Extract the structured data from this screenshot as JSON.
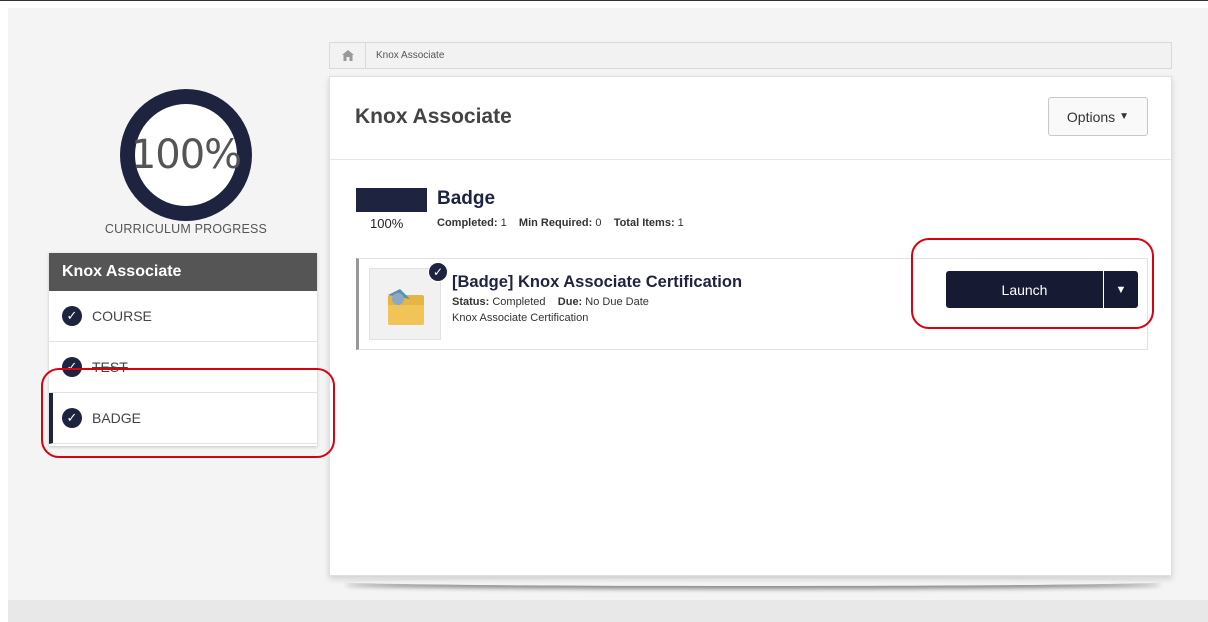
{
  "progress": {
    "percent_label": "100%",
    "caption": "CURRICULUM PROGRESS",
    "value": 1.0
  },
  "sidebar": {
    "title": "Knox Associate",
    "items": [
      {
        "label": "COURSE",
        "icon": "check-circle-icon"
      },
      {
        "label": "TEST",
        "icon": "check-circle-icon"
      },
      {
        "label": "BADGE",
        "icon": "check-circle-icon"
      }
    ]
  },
  "breadcrumb": {
    "home_icon": "home-icon",
    "current": "Knox Associate"
  },
  "main": {
    "title": "Knox Associate",
    "options_label": "Options",
    "section": {
      "title": "Badge",
      "percent_label": "100%",
      "completed_label": "Completed:",
      "completed_value": "1",
      "min_required_label": "Min Required:",
      "min_required_value": "0",
      "total_items_label": "Total Items:",
      "total_items_value": "1"
    },
    "item": {
      "title": "[Badge] Knox Associate Certification",
      "status_label": "Status:",
      "status_value": "Completed",
      "due_label": "Due:",
      "due_value": "No Due Date",
      "description": "Knox Associate Certification",
      "launch_label": "Launch",
      "thumb_icon": "badge-folder-icon"
    }
  },
  "colors": {
    "accent": "#1e2340",
    "callout": "#d9000f",
    "sidebar_header": "#555555"
  }
}
